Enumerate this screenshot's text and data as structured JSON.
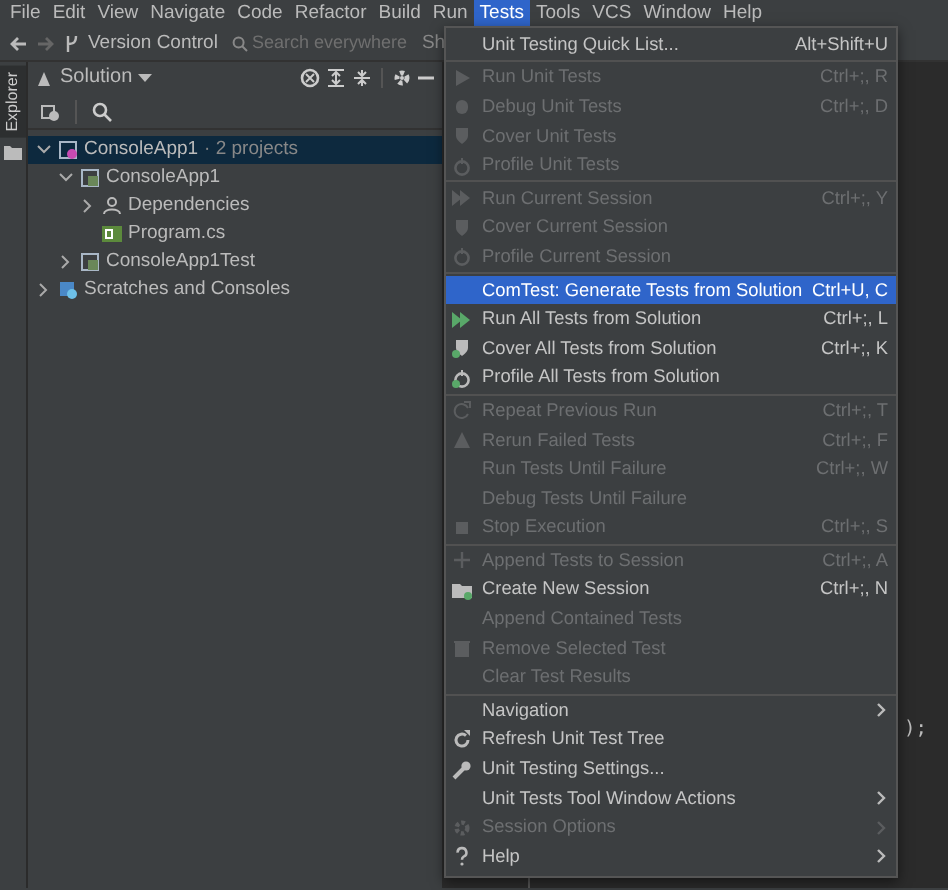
{
  "menu_bar": [
    {
      "label": "File",
      "selected": false
    },
    {
      "label": "Edit",
      "selected": false
    },
    {
      "label": "View",
      "selected": false
    },
    {
      "label": "Navigate",
      "selected": false
    },
    {
      "label": "Code",
      "selected": false
    },
    {
      "label": "Refactor",
      "selected": false
    },
    {
      "label": "Build",
      "selected": false
    },
    {
      "label": "Run",
      "selected": false
    },
    {
      "label": "Tests",
      "selected": true
    },
    {
      "label": "Tools",
      "selected": false
    },
    {
      "label": "VCS",
      "selected": false
    },
    {
      "label": "Window",
      "selected": false
    },
    {
      "label": "Help",
      "selected": false
    }
  ],
  "toolbar": {
    "vcs_label": "Version Control",
    "search": {
      "placeholder": "Search everywhere"
    },
    "cut_text": "Sh"
  },
  "side_stripe": {
    "label": "Explorer"
  },
  "solution_panel": {
    "title": "Solution",
    "tree": [
      {
        "label": "ConsoleApp1",
        "note": "· 2 projects",
        "selected": true,
        "expanded": true,
        "children": [
          {
            "label": "ConsoleApp1",
            "selected": false,
            "expanded": true,
            "children": [
              {
                "label": "Dependencies",
                "selected": false,
                "expanded": false
              },
              {
                "label": "Program.cs",
                "selected": false
              }
            ]
          },
          {
            "label": "ConsoleApp1Test",
            "selected": false,
            "expanded": false
          }
        ]
      },
      {
        "label": "Scratches and Consoles",
        "selected": false,
        "expanded": false
      }
    ]
  },
  "editor": {
    "text": ");"
  },
  "menu": [
    {
      "kind": "item",
      "label": "Unit Testing Quick List...",
      "shortcut": "Alt+Shift+U",
      "disabled": false,
      "selected": false
    },
    {
      "kind": "separator"
    },
    {
      "kind": "item",
      "label": "Run Unit Tests",
      "shortcut": "Ctrl+;, R",
      "disabled": true,
      "selected": false
    },
    {
      "kind": "item",
      "label": "Debug Unit Tests",
      "shortcut": "Ctrl+;, D",
      "disabled": true,
      "selected": false
    },
    {
      "kind": "item",
      "label": "Cover Unit Tests",
      "disabled": true,
      "selected": false
    },
    {
      "kind": "item",
      "label": "Profile Unit Tests",
      "disabled": true,
      "selected": false
    },
    {
      "kind": "separator"
    },
    {
      "kind": "item",
      "label": "Run Current Session",
      "shortcut": "Ctrl+;, Y",
      "disabled": true,
      "selected": false
    },
    {
      "kind": "item",
      "label": "Cover Current Session",
      "disabled": true,
      "selected": false
    },
    {
      "kind": "item",
      "label": "Profile Current Session",
      "disabled": true,
      "selected": false
    },
    {
      "kind": "separator"
    },
    {
      "kind": "item",
      "label": "ComTest: Generate Tests from Solution",
      "shortcut": "Ctrl+U, C",
      "disabled": false,
      "selected": true
    },
    {
      "kind": "item",
      "label": "Run All Tests from Solution",
      "shortcut": "Ctrl+;, L",
      "disabled": false,
      "selected": false
    },
    {
      "kind": "item",
      "label": "Cover All Tests from Solution",
      "shortcut": "Ctrl+;, K",
      "disabled": false,
      "selected": false
    },
    {
      "kind": "item",
      "label": "Profile All Tests from Solution",
      "disabled": false,
      "selected": false
    },
    {
      "kind": "separator"
    },
    {
      "kind": "item",
      "label": "Repeat Previous Run",
      "shortcut": "Ctrl+;, T",
      "disabled": true,
      "selected": false
    },
    {
      "kind": "item",
      "label": "Rerun Failed Tests",
      "shortcut": "Ctrl+;, F",
      "disabled": true,
      "selected": false
    },
    {
      "kind": "item",
      "label": "Run Tests Until Failure",
      "shortcut": "Ctrl+;, W",
      "disabled": true,
      "selected": false
    },
    {
      "kind": "item",
      "label": "Debug Tests Until Failure",
      "disabled": true,
      "selected": false
    },
    {
      "kind": "item",
      "label": "Stop Execution",
      "shortcut": "Ctrl+;, S",
      "disabled": true,
      "selected": false
    },
    {
      "kind": "separator"
    },
    {
      "kind": "item",
      "label": "Append Tests to Session",
      "shortcut": "Ctrl+;, A",
      "disabled": true,
      "selected": false
    },
    {
      "kind": "item",
      "label": "Create New Session",
      "shortcut": "Ctrl+;, N",
      "disabled": false,
      "selected": false
    },
    {
      "kind": "item",
      "label": "Append Contained Tests",
      "disabled": true,
      "selected": false
    },
    {
      "kind": "item",
      "label": "Remove Selected Test",
      "disabled": true,
      "selected": false
    },
    {
      "kind": "item",
      "label": "Clear Test Results",
      "disabled": true,
      "selected": false
    },
    {
      "kind": "separator"
    },
    {
      "kind": "item",
      "label": "Navigation",
      "submenu": true,
      "disabled": false,
      "selected": false
    },
    {
      "kind": "item",
      "label": "Refresh Unit Test Tree",
      "disabled": false,
      "selected": false
    },
    {
      "kind": "item",
      "label": "Unit Testing Settings...",
      "disabled": false,
      "selected": false
    },
    {
      "kind": "item",
      "label": "Unit Tests Tool Window Actions",
      "submenu": true,
      "disabled": false,
      "selected": false
    },
    {
      "kind": "item",
      "label": "Session Options",
      "submenu": true,
      "disabled": true,
      "selected": false
    },
    {
      "kind": "item",
      "label": "Help",
      "submenu": true,
      "disabled": false,
      "selected": false
    }
  ]
}
